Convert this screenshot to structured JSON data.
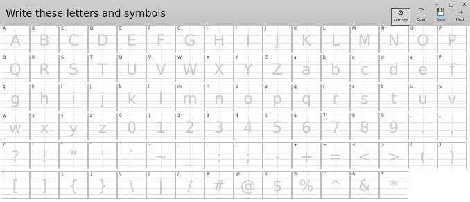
{
  "app": {
    "title": "Write these letters and symbols"
  },
  "window_controls": [
    "–",
    "▢",
    "✕"
  ],
  "toolbar": [
    {
      "name": "settings-button",
      "icon": "gear-icon",
      "glyph": "⚙",
      "label": "Settings",
      "active": true
    },
    {
      "name": "open-button",
      "icon": "document-icon",
      "glyph": "🗋",
      "label": "Open",
      "active": false
    },
    {
      "name": "save-button",
      "icon": "floppy-disk-icon",
      "glyph": "💾",
      "label": "Save",
      "active": false
    },
    {
      "name": "next-button",
      "icon": "arrow-right-icon",
      "glyph": "→",
      "label": "Next",
      "active": false
    }
  ],
  "cells": [
    "A",
    "B",
    "C",
    "D",
    "E",
    "F",
    "G",
    "H",
    "I",
    "J",
    "K",
    "L",
    "M",
    "N",
    "O",
    "P",
    "Q",
    "R",
    "S",
    "T",
    "U",
    "V",
    "W",
    "X",
    "Y",
    "Z",
    "a",
    "b",
    "c",
    "d",
    "e",
    "f",
    "g",
    "h",
    "i",
    "j",
    "k",
    "l",
    "m",
    "n",
    "o",
    "p",
    "q",
    "r",
    "s",
    "t",
    "u",
    "v",
    "w",
    "x",
    "y",
    "z",
    "0",
    "1",
    "2",
    "3",
    "4",
    "5",
    "6",
    "7",
    "8",
    "9",
    ".",
    ",",
    "?",
    "!",
    "\"",
    "'",
    "`",
    "~",
    "_",
    ":",
    ";",
    "-",
    "+",
    "=",
    "<",
    ">",
    "(",
    ")",
    "[",
    "]",
    "{",
    "}",
    "\\",
    "|",
    "/",
    "#",
    "@",
    "$",
    "%",
    "^",
    "&",
    "*"
  ]
}
